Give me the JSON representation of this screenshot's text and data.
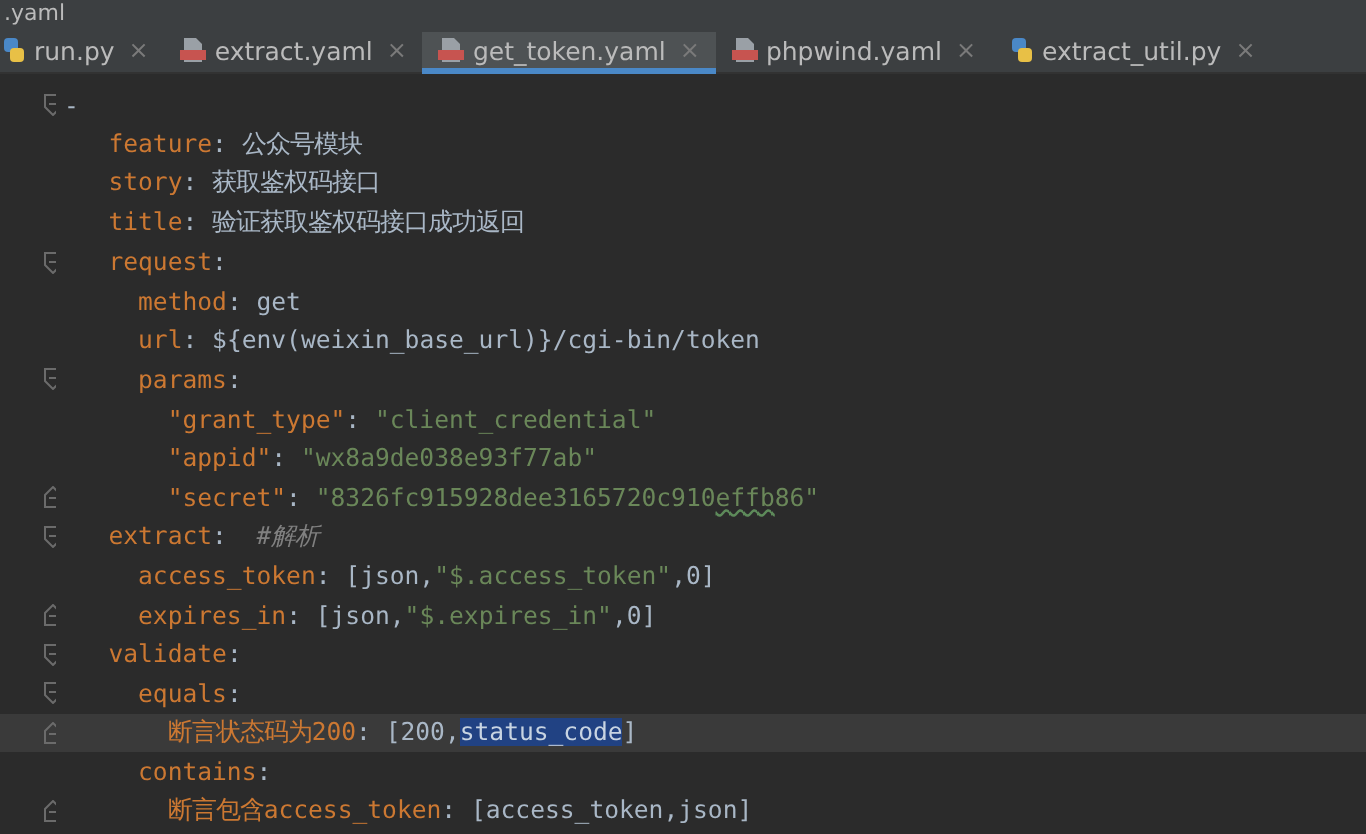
{
  "window": {
    "title": ".yaml"
  },
  "tabs": [
    {
      "label": "run.py",
      "kind": "python",
      "selected": false
    },
    {
      "label": "extract.yaml",
      "kind": "yaml",
      "selected": false
    },
    {
      "label": "get_token.yaml",
      "kind": "yaml",
      "selected": true
    },
    {
      "label": "phpwind.yaml",
      "kind": "yaml",
      "selected": false
    },
    {
      "label": "extract_util.py",
      "kind": "python",
      "selected": false
    }
  ],
  "tab_close": "×",
  "lines": [
    {
      "kind": "opener",
      "current": false,
      "segments": [
        {
          "kind": "plain",
          "text": "-"
        }
      ],
      "children": [
        {
          "kind": "line",
          "current": false,
          "segments": [
            {
              "kind": "key",
              "text": "feature"
            },
            {
              "kind": "plain",
              "text": ": 公众号模块"
            }
          ]
        },
        {
          "kind": "line",
          "current": false,
          "segments": [
            {
              "kind": "key",
              "text": "story"
            },
            {
              "kind": "plain",
              "text": ": 获取鉴权码接口"
            }
          ]
        },
        {
          "kind": "line",
          "current": false,
          "segments": [
            {
              "kind": "key",
              "text": "title"
            },
            {
              "kind": "plain",
              "text": ": 验证获取鉴权码接口成功返回"
            }
          ]
        },
        {
          "kind": "opener",
          "current": false,
          "segments": [
            {
              "kind": "key",
              "text": "request"
            },
            {
              "kind": "plain",
              "text": ":"
            }
          ],
          "children": [
            {
              "kind": "line",
              "current": false,
              "segments": [
                {
                  "kind": "key",
                  "text": "method"
                },
                {
                  "kind": "plain",
                  "text": ": get"
                }
              ]
            },
            {
              "kind": "line",
              "current": false,
              "segments": [
                {
                  "kind": "key",
                  "text": "url"
                },
                {
                  "kind": "plain",
                  "text": ": ${env(weixin_base_url)}/cgi-bin/token"
                }
              ]
            },
            {
              "kind": "opener",
              "current": false,
              "segments": [
                {
                  "kind": "key",
                  "text": "params"
                },
                {
                  "kind": "plain",
                  "text": ":"
                }
              ],
              "children": [
                {
                  "kind": "line",
                  "current": false,
                  "segments": [
                    {
                      "kind": "key",
                      "text": "\"grant_type\""
                    },
                    {
                      "kind": "plain",
                      "text": ": "
                    },
                    {
                      "kind": "string",
                      "text": "\"client_credential\""
                    }
                  ]
                },
                {
                  "kind": "line",
                  "current": false,
                  "segments": [
                    {
                      "kind": "key",
                      "text": "\"appid\""
                    },
                    {
                      "kind": "plain",
                      "text": ": "
                    },
                    {
                      "kind": "string",
                      "text": "\"wx8a9de038e93f77ab\""
                    }
                  ]
                },
                {
                  "kind": "closer",
                  "current": false,
                  "segments": [
                    {
                      "kind": "key",
                      "text": "\"secret\""
                    },
                    {
                      "kind": "plain",
                      "text": ": "
                    },
                    {
                      "kind": "string",
                      "text": "\"8326fc915928dee3165720c910"
                    },
                    {
                      "kind": "typo",
                      "text": "effb"
                    },
                    {
                      "kind": "string",
                      "text": "86\""
                    }
                  ]
                }
              ]
            }
          ]
        },
        {
          "kind": "opener",
          "current": false,
          "segments": [
            {
              "kind": "key",
              "text": "extract"
            },
            {
              "kind": "plain",
              "text": ":  "
            },
            {
              "kind": "comment",
              "text": "#解析"
            }
          ],
          "children": [
            {
              "kind": "line",
              "current": false,
              "segments": [
                {
                  "kind": "key",
                  "text": "access_token"
                },
                {
                  "kind": "plain",
                  "text": ": [json,"
                },
                {
                  "kind": "string",
                  "text": "\"$.access_token\""
                },
                {
                  "kind": "plain",
                  "text": ",0]"
                }
              ]
            },
            {
              "kind": "closer",
              "current": false,
              "segments": [
                {
                  "kind": "key",
                  "text": "expires_in"
                },
                {
                  "kind": "plain",
                  "text": ": [json,"
                },
                {
                  "kind": "string",
                  "text": "\"$.expires_in\""
                },
                {
                  "kind": "plain",
                  "text": ",0]"
                }
              ]
            }
          ]
        },
        {
          "kind": "opener",
          "current": false,
          "segments": [
            {
              "kind": "key",
              "text": "validate"
            },
            {
              "kind": "plain",
              "text": ":"
            }
          ],
          "children": [
            {
              "kind": "opener",
              "current": false,
              "segments": [
                {
                  "kind": "key",
                  "text": "equals"
                },
                {
                  "kind": "plain",
                  "text": ":"
                }
              ],
              "children": [
                {
                  "kind": "closer",
                  "current": true,
                  "segments": [
                    {
                      "kind": "key",
                      "text": "断言状态码为200"
                    },
                    {
                      "kind": "plain",
                      "text": ": [200,"
                    },
                    {
                      "kind": "selected",
                      "text": "status_code"
                    },
                    {
                      "kind": "plain",
                      "text": "]"
                    }
                  ]
                }
              ]
            },
            {
              "kind": "line",
              "current": false,
              "segments": [
                {
                  "kind": "key",
                  "text": "contains"
                },
                {
                  "kind": "plain",
                  "text": ":"
                }
              ],
              "children": [
                {
                  "kind": "closer",
                  "current": false,
                  "segments": [
                    {
                      "kind": "key",
                      "text": "断言包含access_token"
                    },
                    {
                      "kind": "plain",
                      "text": ": [access_token,json]"
                    }
                  ]
                }
              ]
            }
          ]
        }
      ]
    }
  ]
}
